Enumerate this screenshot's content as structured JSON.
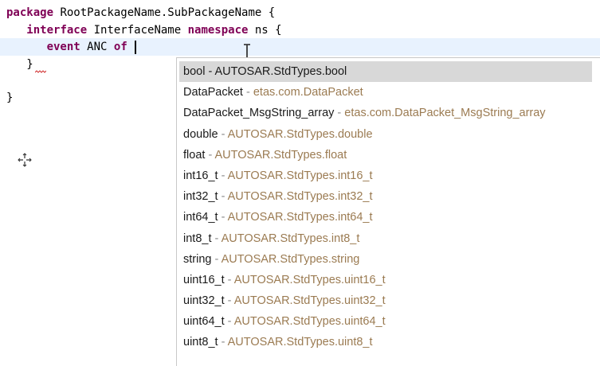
{
  "editor": {
    "lines": {
      "l1_kw": "package",
      "l1_text": " RootPackageName.SubPackageName {",
      "l2_indent": "   ",
      "l2_kw1": "interface",
      "l2_text1": " InterfaceName ",
      "l2_kw2": "namespace",
      "l2_text2": " ns {",
      "l3_indent": "      ",
      "l3_kw1": "event",
      "l3_text1": " ANC ",
      "l3_kw2": "of",
      "l3_text2": " ",
      "l4_text": "   }",
      "l6_text": "}"
    }
  },
  "content_assist": {
    "separator": " - ",
    "proposals": [
      {
        "type": "bool",
        "qualifier": "AUTOSAR.StdTypes.bool",
        "selected": true
      },
      {
        "type": "DataPacket",
        "qualifier": "etas.com.DataPacket",
        "selected": false
      },
      {
        "type": "DataPacket_MsgString_array",
        "qualifier": "etas.com.DataPacket_MsgString_array",
        "selected": false
      },
      {
        "type": "double",
        "qualifier": "AUTOSAR.StdTypes.double",
        "selected": false
      },
      {
        "type": "float",
        "qualifier": "AUTOSAR.StdTypes.float",
        "selected": false
      },
      {
        "type": "int16_t",
        "qualifier": "AUTOSAR.StdTypes.int16_t",
        "selected": false
      },
      {
        "type": "int32_t",
        "qualifier": "AUTOSAR.StdTypes.int32_t",
        "selected": false
      },
      {
        "type": "int64_t",
        "qualifier": "AUTOSAR.StdTypes.int64_t",
        "selected": false
      },
      {
        "type": "int8_t",
        "qualifier": "AUTOSAR.StdTypes.int8_t",
        "selected": false
      },
      {
        "type": "string",
        "qualifier": "AUTOSAR.StdTypes.string",
        "selected": false
      },
      {
        "type": "uint16_t",
        "qualifier": "AUTOSAR.StdTypes.uint16_t",
        "selected": false
      },
      {
        "type": "uint32_t",
        "qualifier": "AUTOSAR.StdTypes.uint32_t",
        "selected": false
      },
      {
        "type": "uint64_t",
        "qualifier": "AUTOSAR.StdTypes.uint64_t",
        "selected": false
      },
      {
        "type": "uint8_t",
        "qualifier": "AUTOSAR.StdTypes.uint8_t",
        "selected": false
      }
    ]
  },
  "colors": {
    "keyword": "#7f0055",
    "current_line": "#e8f2fe",
    "selection": "#d8d8d8",
    "qualifier": "#9b7b52"
  },
  "icons": {
    "text_cursor": "ibeam-cursor-icon",
    "move_cursor": "move-cursor-icon",
    "error_marker": "error-squiggle-icon"
  }
}
